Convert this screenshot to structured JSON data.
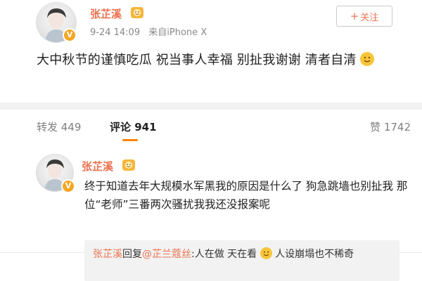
{
  "post": {
    "username": "张芷溪",
    "time": "9-24 14:09",
    "source": "来自iPhone X",
    "follow_label": "关注",
    "text": "大中秋节的谨慎吃瓜 祝当事人幸福 别扯我谢谢 清者自清"
  },
  "tabs": {
    "repost": "转发 449",
    "comment": "评论 941",
    "like": "赞 1742"
  },
  "comment": {
    "username": "张芷溪",
    "text": "终于知道去年大规模水军黑我的原因是什么了 狗急跳墙也别扯我 那位“老师”三番两次骚扰我我还没报案呢",
    "subreply": {
      "author": "张芷溪",
      "action": "回复",
      "target": "@芷兰蔻丝",
      "text_before_emoji": ":人在做 天在看",
      "text_after_emoji": " 人设崩塌也不稀奇"
    }
  },
  "colors": {
    "username": "#eb7350",
    "accent": "#ff8200",
    "badge": "#f5a623"
  },
  "icons": {
    "verified_badge": "V",
    "follow_plus": "+"
  }
}
